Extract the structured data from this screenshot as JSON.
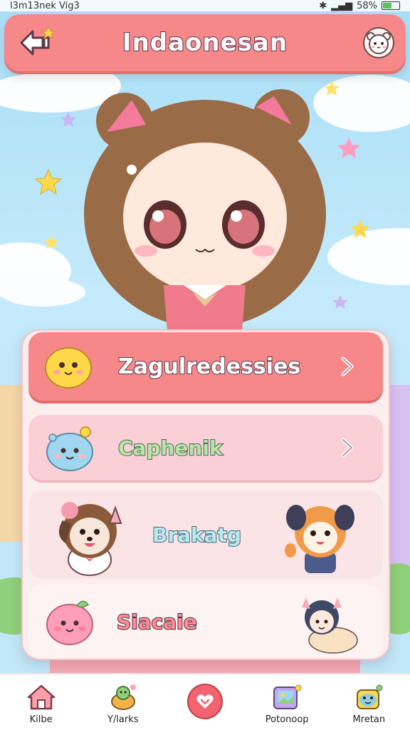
{
  "status_bar": {
    "left_text": "l3m13nek Vig3",
    "battery": "58%",
    "battery_level": 0.58
  },
  "header": {
    "title": "Indaonesan"
  },
  "menu": {
    "items": [
      {
        "label": "Zagulredessies",
        "icon": "yellow-blob-icon",
        "has_chevron": true
      },
      {
        "label": "Caphenik",
        "icon": "blue-blob-icon",
        "has_chevron": true
      },
      {
        "label": "Brakatg",
        "icon": "puppy-icon",
        "has_chevron": false
      },
      {
        "label": "Siacaie",
        "icon": "pink-blob-icon",
        "has_chevron": false
      }
    ]
  },
  "bottom_nav": {
    "items": [
      {
        "label": "Kilbe",
        "icon": "home-icon"
      },
      {
        "label": "Y/larks",
        "icon": "turtle-icon"
      },
      {
        "label": "",
        "icon": "heart-icon"
      },
      {
        "label": "Potonoop",
        "icon": "photo-icon"
      },
      {
        "label": "Mretan",
        "icon": "frog-icon"
      }
    ]
  },
  "colors": {
    "accent": "#f7888a",
    "sky": "#a9def6",
    "panel": "#fdeeee"
  }
}
